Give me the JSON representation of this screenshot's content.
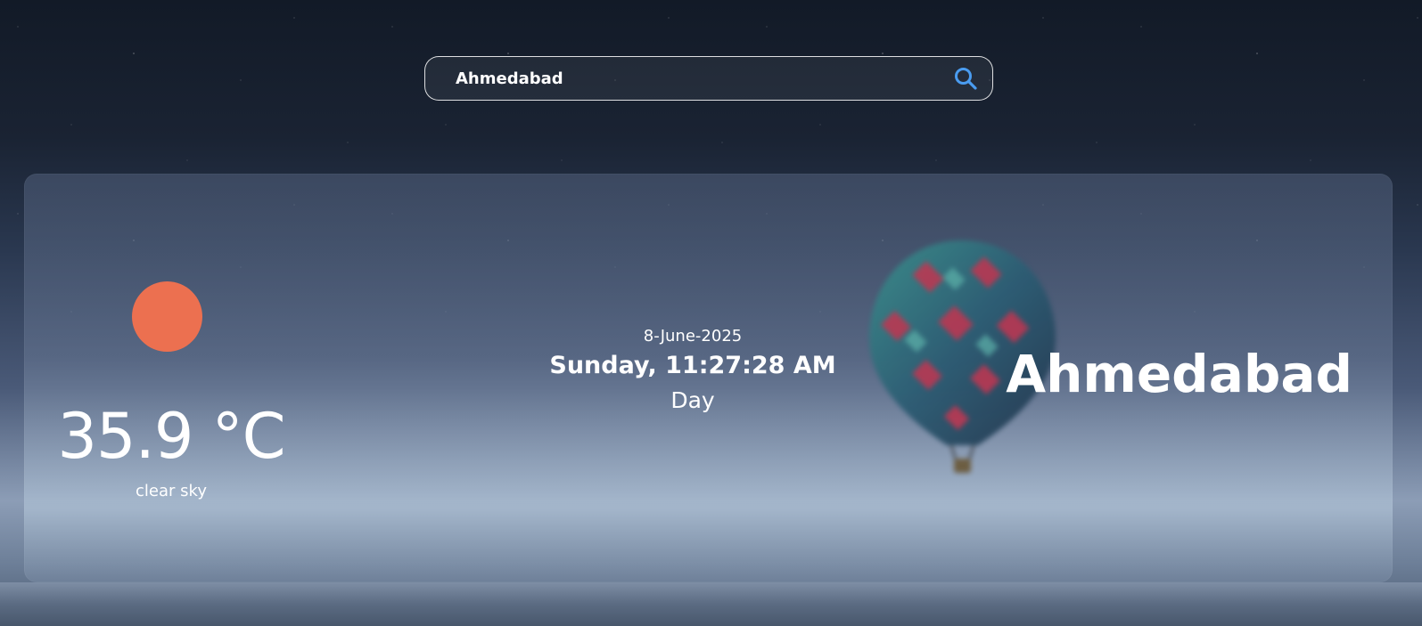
{
  "search": {
    "value": "Ahmedabad",
    "placeholder": "",
    "icon": "search-icon"
  },
  "weather": {
    "icon": "sun-icon",
    "temperature": "35.9 °C",
    "condition": "clear sky",
    "date": "8-June-2025",
    "datetime": "Sunday, 11:27:28 AM",
    "period": "Day",
    "city": "Ahmedabad"
  },
  "colors": {
    "sun": "#ec7050",
    "search_icon": "#4a9cf0",
    "text": "#ffffff"
  }
}
